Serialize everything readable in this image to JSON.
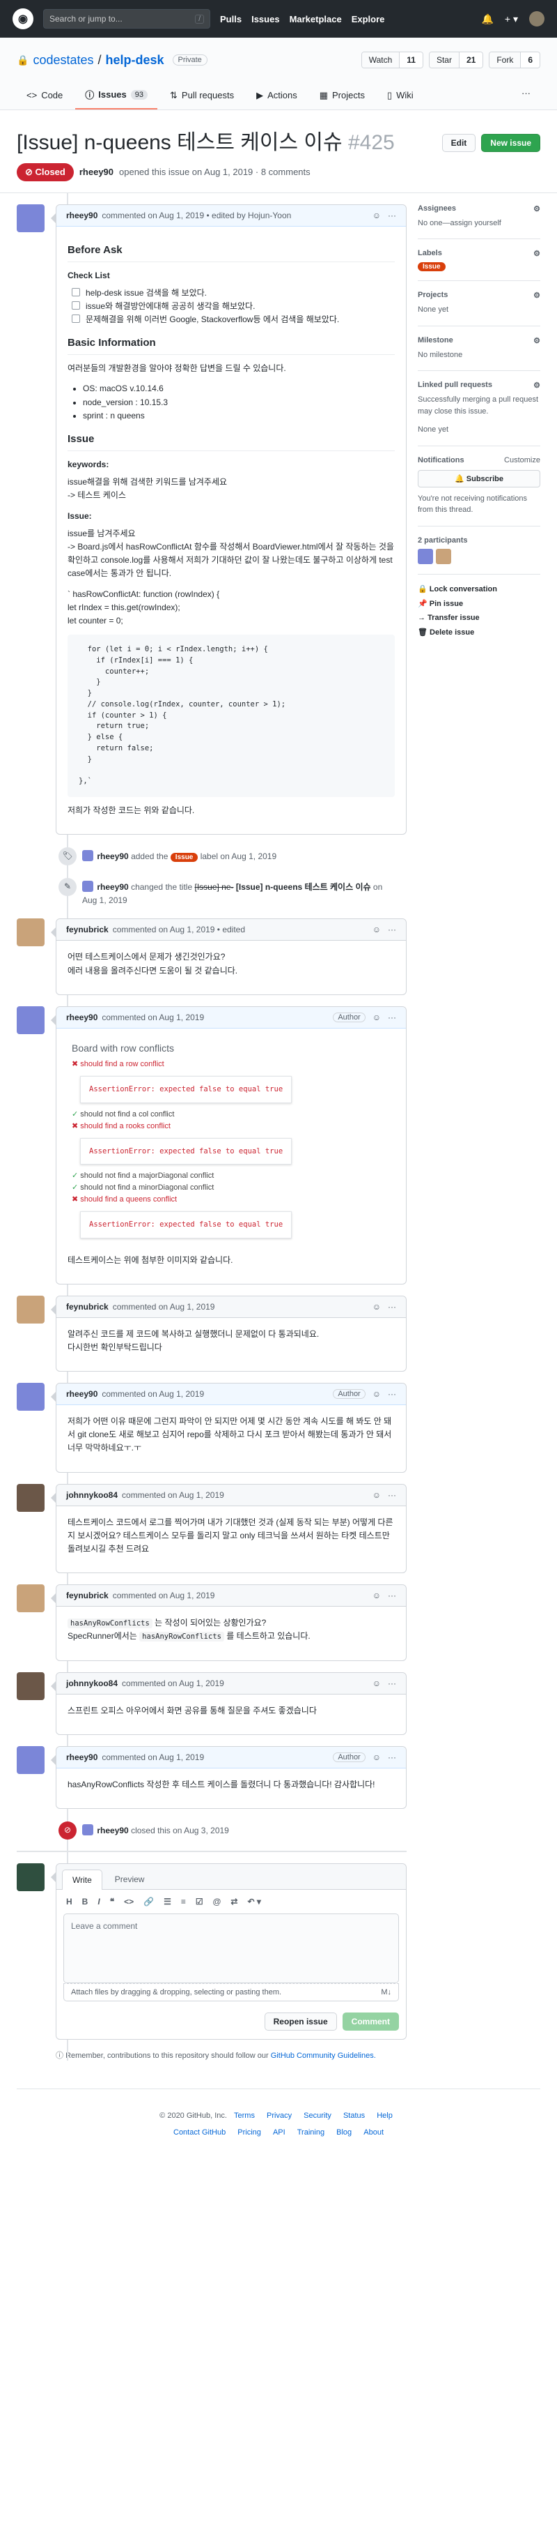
{
  "header": {
    "search_placeholder": "Search or jump to...",
    "search_key": "/",
    "nav": [
      "Pulls",
      "Issues",
      "Marketplace",
      "Explore"
    ]
  },
  "repo": {
    "owner": "codestates",
    "name": "help-desk",
    "visibility": "Private",
    "watch_label": "Watch",
    "watch_count": "11",
    "star_label": "Star",
    "star_count": "21",
    "fork_label": "Fork",
    "fork_count": "6",
    "tabs": [
      {
        "label": "Code"
      },
      {
        "label": "Issues",
        "count": "93"
      },
      {
        "label": "Pull requests"
      },
      {
        "label": "Actions"
      },
      {
        "label": "Projects"
      },
      {
        "label": "Wiki"
      }
    ]
  },
  "issue": {
    "title": "[Issue] n-queens 테스트 케이스 이슈",
    "number": "#425",
    "state": "Closed",
    "author": "rheey90",
    "meta": "opened this issue on Aug 1, 2019 · 8 comments",
    "edit_label": "Edit",
    "new_issue_label": "New issue"
  },
  "comments": [
    {
      "author": "rheey90",
      "meta": "commented on Aug 1, 2019 • edited by Hojun-Yoon",
      "before_ask_title": "Before Ask",
      "checklist_title": "Check List",
      "checklist": [
        "help-desk issue 검색을 해 보았다.",
        "issue와 해결방안에대해 공공히 생각을 해보았다.",
        "문제해결을 위해 이러번 Google, Stackoverflow등 에서 검색을 해보았다."
      ],
      "basic_info_title": "Basic Information",
      "basic_info_desc": "여러분들의 개발환경을 알아야 정확한 답변을 드릴 수 있습니다.",
      "basic_info": [
        "OS: macOS v.10.14.6",
        "node_version : 10.15.3",
        "sprint : n queens"
      ],
      "issue_title": "Issue",
      "keywords_label": "keywords:",
      "keywords_text1": "issue해결을 위해 검색한 키워드를 남겨주세요",
      "keywords_text2": "-> 테스트 케이스",
      "issue_label": "Issue:",
      "issue_text1": "issue를 남겨주세요",
      "issue_text2": "-> Board.js에서 hasRowConflictAt 함수를 작성해서 BoardViewer.html에서 잘 작동하는 것을 확인하고 console.log를 사용해서 저희가 기대하던 값이 잘 나왔는데도 불구하고 이상하게 test case에서는 통과가 안 됩니다.",
      "code_inline1": "` hasRowConflictAt: function (rowIndex) {",
      "code_inline2": "let rIndex = this.get(rowIndex);",
      "code_inline3": "let counter = 0;",
      "code_block": "  for (let i = 0; i < rIndex.length; i++) {\n    if (rIndex[i] === 1) {\n      counter++;\n    }\n  }\n  // console.log(rIndex, counter, counter > 1);\n  if (counter > 1) {\n    return true;\n  } else {\n    return false;\n  }\n\n},`",
      "closing_text": "저희가 작성한 코드는 위와 같습니다."
    },
    {
      "author": "feynubrick",
      "meta": "commented on Aug 1, 2019 • edited",
      "line1": "어떤 테스트케이스에서 문제가 생긴것인가요?",
      "line2": "에러 내용을 올려주신다면 도움이 될 것 같습니다."
    },
    {
      "author": "rheey90",
      "meta": "commented on Aug 1, 2019",
      "author_tag": "Author",
      "suite_title": "Board with row conflicts",
      "tests": [
        {
          "type": "fail",
          "text": "should find a row conflict"
        },
        {
          "type": "error",
          "text": "AssertionError: expected false to equal true"
        },
        {
          "type": "pass",
          "text": "should not find a col conflict"
        },
        {
          "type": "fail",
          "text": "should find a rooks conflict"
        },
        {
          "type": "error",
          "text": "AssertionError: expected false to equal true"
        },
        {
          "type": "pass",
          "text": "should not find a majorDiagonal conflict"
        },
        {
          "type": "pass",
          "text": "should not find a minorDiagonal conflict"
        },
        {
          "type": "fail",
          "text": "should find a queens conflict"
        },
        {
          "type": "error",
          "text": "AssertionError: expected false to equal true"
        }
      ],
      "text": "테스트케이스는 위에 첨부한 이미지와 같습니다."
    },
    {
      "author": "feynubrick",
      "meta": "commented on Aug 1, 2019",
      "line1": "알려주신 코드를 제 코드에 복사하고 실행했더니 문제없이 다 통과되네요.",
      "line2": "다시한번 확인부탁드립니다"
    },
    {
      "author": "rheey90",
      "meta": "commented on Aug 1, 2019",
      "author_tag": "Author",
      "text": "저희가 어떤 이유 때문에 그런지 파악이 안 되지만 어제 몇 시간 동안 계속 시도를 해 봐도 안 돼서 git clone도 새로 해보고 심지어 repo를 삭제하고 다시 포크 받아서 해봤는데 통과가 안 돼서 너무 막막하네요ㅜ.ㅜ"
    },
    {
      "author": "johnnykoo84",
      "meta": "commented on Aug 1, 2019",
      "text": "테스트케이스 코드에서 로그를 찍어가며 내가 기대했던 것과 (실제 동작 되는 부분) 어떻게 다른지 보시겠어요? 테스트케이스 모두를 돌리지 말고 only 테크닉을 쓰셔서 원하는 타켓 테스트만 돌려보시길 추천 드려요"
    },
    {
      "author": "feynubrick",
      "meta": "commented on Aug 1, 2019",
      "code1": "hasAnyRowConflicts",
      "text1": " 는 작성이 되어있는 상황인가요?",
      "text2a": "SpecRunner에서는 ",
      "code2": "hasAnyRowConflicts",
      "text2b": " 를 테스트하고 있습니다."
    },
    {
      "author": "johnnykoo84",
      "meta": "commented on Aug 1, 2019",
      "text": "스프린트 오피스 아우어에서 화면 공유를 통해 질문을 주셔도 좋겠습니다"
    },
    {
      "author": "rheey90",
      "meta": "commented on Aug 1, 2019",
      "author_tag": "Author",
      "text": "hasAnyRowConflicts 작성한 후 테스트 케이스를 돌렸더니 다 통과했습니다! 감사합니다!"
    }
  ],
  "events": {
    "label_event_author": "rheey90",
    "label_event_text1": "added the",
    "label_name": "Issue",
    "label_event_text2": "label on Aug 1, 2019",
    "rename_author": "rheey90",
    "rename_text": "changed the title",
    "rename_old": "[Issue] ne-",
    "rename_new": "[Issue] n-queens 테스트 케이스 이슈",
    "rename_date": "on Aug 1, 2019",
    "closed_author": "rheey90",
    "closed_text": "closed this on Aug 3, 2019"
  },
  "sidebar": {
    "assignees_title": "Assignees",
    "assignees_text": "No one—assign yourself",
    "labels_title": "Labels",
    "label_value": "Issue",
    "projects_title": "Projects",
    "projects_text": "None yet",
    "milestone_title": "Milestone",
    "milestone_text": "No milestone",
    "linked_title": "Linked pull requests",
    "linked_text": "Successfully merging a pull request may close this issue.",
    "linked_none": "None yet",
    "notifications_title": "Notifications",
    "customize": "Customize",
    "subscribe": "Subscribe",
    "notif_text": "You're not receiving notifications from this thread.",
    "participants_title": "2 participants",
    "lock": "Lock conversation",
    "pin": "Pin issue",
    "transfer": "Transfer issue",
    "delete": "Delete issue"
  },
  "composer": {
    "write_tab": "Write",
    "preview_tab": "Preview",
    "placeholder": "Leave a comment",
    "attach_text": "Attach files by dragging & dropping, selecting or pasting them.",
    "reopen_label": "Reopen issue",
    "comment_label": "Comment",
    "guideline_text": "Remember, contributions to this repository should follow our",
    "guideline_link": "GitHub Community Guidelines."
  },
  "footer": {
    "copyright": "© 2020 GitHub, Inc.",
    "links1": [
      "Terms",
      "Privacy",
      "Security",
      "Status",
      "Help"
    ],
    "links2": [
      "Contact GitHub",
      "Pricing",
      "API",
      "Training",
      "Blog",
      "About"
    ]
  },
  "colors": {
    "header_bg": "#24292e",
    "closed_red": "#cb2431",
    "label_orange": "#d93f0b",
    "primary_green": "#2ea44f"
  }
}
